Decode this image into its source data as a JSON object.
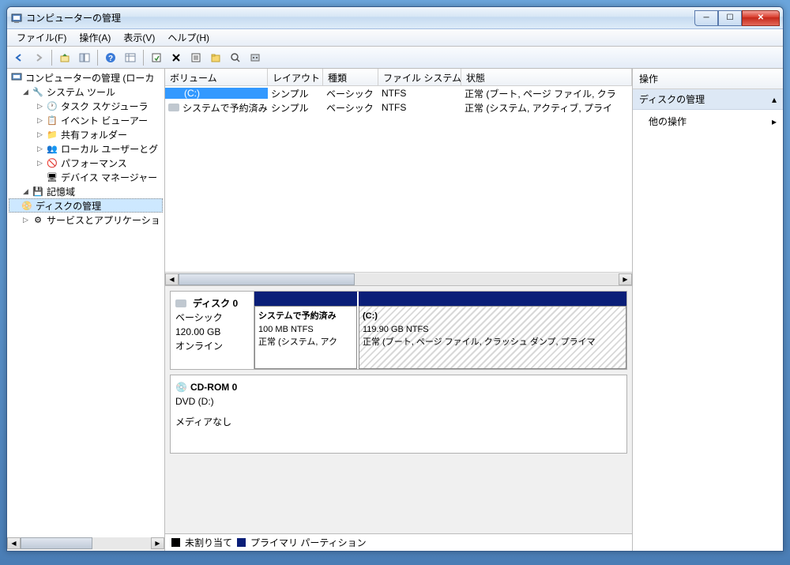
{
  "window": {
    "title": "コンピューターの管理"
  },
  "menus": {
    "file": "ファイル(F)",
    "action": "操作(A)",
    "view": "表示(V)",
    "help": "ヘルプ(H)"
  },
  "tree": {
    "root": "コンピューターの管理 (ローカ",
    "systools": "システム ツール",
    "tasksch": "タスク スケジューラ",
    "eventv": "イベント ビューアー",
    "shared": "共有フォルダー",
    "users": "ローカル ユーザーとグ",
    "perf": "パフォーマンス",
    "devmgr": "デバイス マネージャー",
    "storage": "記憶域",
    "diskmgmt": "ディスクの管理",
    "services": "サービスとアプリケーショ"
  },
  "volumes": {
    "headers": {
      "volume": "ボリューム",
      "layout": "レイアウト",
      "type": "種類",
      "fs": "ファイル システム",
      "status": "状態"
    },
    "rows": [
      {
        "name": "(C:)",
        "layout": "シンプル",
        "type": "ベーシック",
        "fs": "NTFS",
        "status": "正常 (ブート, ページ ファイル, クラ"
      },
      {
        "name": "システムで予約済み",
        "layout": "シンプル",
        "type": "ベーシック",
        "fs": "NTFS",
        "status": "正常 (システム, アクティブ, プライ"
      }
    ]
  },
  "disks": {
    "disk0": {
      "title": "ディスク 0",
      "type": "ベーシック",
      "size": "120.00 GB",
      "status": "オンライン",
      "parts": [
        {
          "name": "システムで予約済み",
          "size": "100 MB NTFS",
          "status": "正常 (システム, アク"
        },
        {
          "name": "(C:)",
          "size": "119.90 GB NTFS",
          "status": "正常 (ブート, ページ ファイル, クラッシュ ダンプ, プライマ"
        }
      ]
    },
    "cdrom": {
      "title": "CD-ROM 0",
      "drive": "DVD (D:)",
      "status": "メディアなし"
    }
  },
  "legend": {
    "unallocated": "未割り当て",
    "primary": "プライマリ パーティション"
  },
  "actions": {
    "title": "操作",
    "section": "ディスクの管理",
    "more": "他の操作"
  }
}
